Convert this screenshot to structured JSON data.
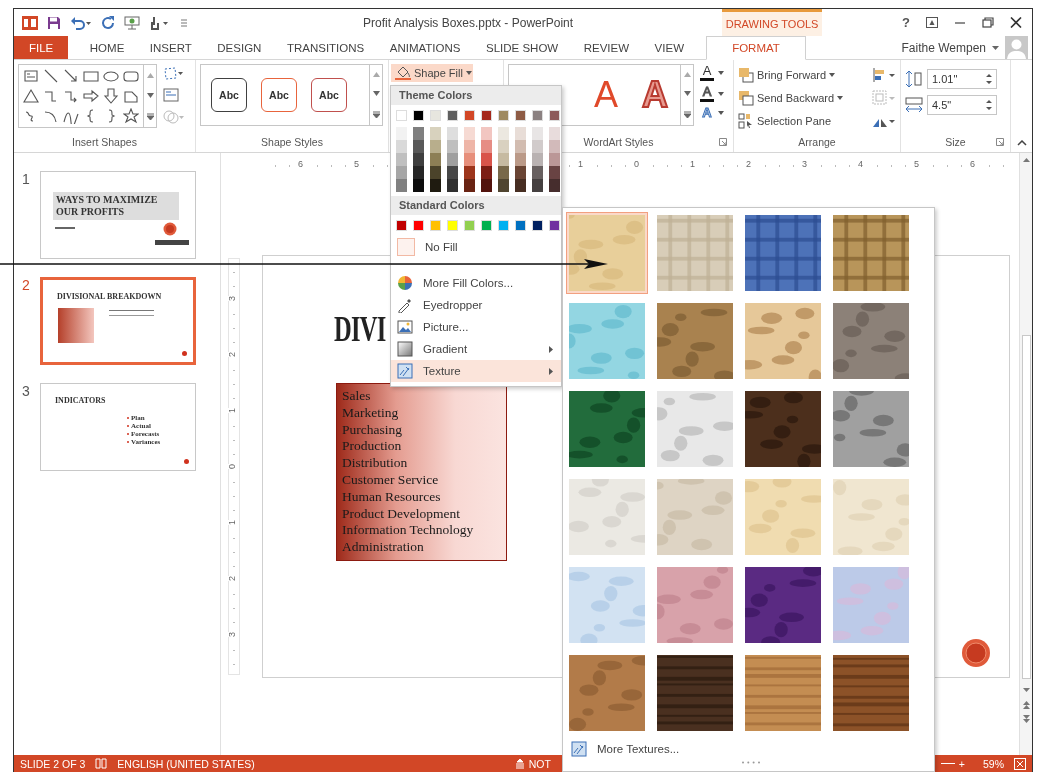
{
  "title_bar": {
    "title": "Profit Analysis Boxes.pptx - PowerPoint",
    "contextual_label": "DRAWING TOOLS",
    "help": "?"
  },
  "tabs": [
    {
      "label": "FILE",
      "kind": "file",
      "selected": false
    },
    {
      "label": "HOME",
      "kind": "tab",
      "selected": false
    },
    {
      "label": "INSERT",
      "kind": "tab",
      "selected": false
    },
    {
      "label": "DESIGN",
      "kind": "tab",
      "selected": false
    },
    {
      "label": "TRANSITIONS",
      "kind": "tab",
      "selected": false
    },
    {
      "label": "ANIMATIONS",
      "kind": "tab",
      "selected": false
    },
    {
      "label": "SLIDE SHOW",
      "kind": "tab",
      "selected": false
    },
    {
      "label": "REVIEW",
      "kind": "tab",
      "selected": false
    },
    {
      "label": "VIEW",
      "kind": "tab",
      "selected": false
    },
    {
      "label": "FORMAT",
      "kind": "contextual",
      "selected": true
    }
  ],
  "user": {
    "name": "Faithe Wempen"
  },
  "ribbon": {
    "insert_shapes": {
      "label": "Insert Shapes"
    },
    "shape_styles": {
      "label": "Shape Styles",
      "styles": [
        {
          "text": "Abc",
          "color": "#404040"
        },
        {
          "text": "Abc",
          "color": "#e8643c"
        },
        {
          "text": "Abc",
          "color": "#c0504d"
        }
      ]
    },
    "shape_fill": {
      "label": "Shape Fill",
      "expanded": true
    },
    "wordart_styles": {
      "label": "WordArt Styles",
      "styles": [
        {
          "text": "A",
          "kind": "fill"
        },
        {
          "text": "A",
          "kind": "outline"
        }
      ],
      "tools": [
        {
          "text": "A",
          "kind": "fill"
        },
        {
          "text": "A",
          "kind": "outline"
        },
        {
          "text": "A",
          "kind": "effects"
        }
      ]
    },
    "arrange": {
      "label": "Arrange",
      "buttons": [
        {
          "label": "Bring Forward",
          "dropdown": true
        },
        {
          "label": "Send Backward",
          "dropdown": true
        },
        {
          "label": "Selection Pane",
          "dropdown": false
        }
      ]
    },
    "size": {
      "label": "Size",
      "height": "1.01\"",
      "width": "4.5\""
    }
  },
  "fill_menu": {
    "theme_header": "Theme Colors",
    "theme_colors": [
      {
        "color": "#ffffff",
        "shades": [
          {
            "color": "#f2f2f2"
          },
          {
            "color": "#d9d9d9"
          },
          {
            "color": "#bfbfbf"
          },
          {
            "color": "#a6a6a6"
          },
          {
            "color": "#808080"
          }
        ]
      },
      {
        "color": "#000000",
        "shades": [
          {
            "color": "#7f7f7f"
          },
          {
            "color": "#595959"
          },
          {
            "color": "#3f3f3f"
          },
          {
            "color": "#262626"
          },
          {
            "color": "#0d0d0d"
          }
        ]
      },
      {
        "color": "#e7e6df",
        "shades": [
          {
            "color": "#d8d2be"
          },
          {
            "color": "#b8ae8c"
          },
          {
            "color": "#8d7f55"
          },
          {
            "color": "#4b432a"
          },
          {
            "color": "#1f1b10"
          }
        ]
      },
      {
        "color": "#5f5f5f",
        "shades": [
          {
            "color": "#dedede"
          },
          {
            "color": "#bfbfbf"
          },
          {
            "color": "#9f9f9f"
          },
          {
            "color": "#474747"
          },
          {
            "color": "#303030"
          }
        ]
      },
      {
        "color": "#d24726",
        "shades": [
          {
            "color": "#f6dad3"
          },
          {
            "color": "#eeb5a7"
          },
          {
            "color": "#e78f7b"
          },
          {
            "color": "#9d351c"
          },
          {
            "color": "#692313"
          }
        ]
      },
      {
        "color": "#a5281b",
        "shades": [
          {
            "color": "#f2c6c1"
          },
          {
            "color": "#e68d84"
          },
          {
            "color": "#d9544a"
          },
          {
            "color": "#7c1d14"
          },
          {
            "color": "#52130d"
          }
        ]
      },
      {
        "color": "#9e8a62",
        "shades": [
          {
            "color": "#ece8e0"
          },
          {
            "color": "#d9d1c0"
          },
          {
            "color": "#c6baa1"
          },
          {
            "color": "#786849"
          },
          {
            "color": "#504530"
          }
        ]
      },
      {
        "color": "#8e5c45",
        "shades": [
          {
            "color": "#e8ddd7"
          },
          {
            "color": "#d2bcb0"
          },
          {
            "color": "#bb9a88"
          },
          {
            "color": "#6a4534"
          },
          {
            "color": "#472e22"
          }
        ]
      },
      {
        "color": "#8b8181",
        "shades": [
          {
            "color": "#e8e5e5"
          },
          {
            "color": "#d1cbcb"
          },
          {
            "color": "#b9b2b2"
          },
          {
            "color": "#686060"
          },
          {
            "color": "#454040"
          }
        ]
      },
      {
        "color": "#8c5a5a",
        "shades": [
          {
            "color": "#e8dcdc"
          },
          {
            "color": "#d2baba"
          },
          {
            "color": "#bb9797"
          },
          {
            "color": "#694343"
          },
          {
            "color": "#462d2d"
          }
        ]
      }
    ],
    "standard_header": "Standard Colors",
    "standard_colors": [
      {
        "color": "#c00000"
      },
      {
        "color": "#ff0000"
      },
      {
        "color": "#ffc000"
      },
      {
        "color": "#ffff00"
      },
      {
        "color": "#92d050"
      },
      {
        "color": "#00b050"
      },
      {
        "color": "#00b0f0"
      },
      {
        "color": "#0070c0"
      },
      {
        "color": "#002060"
      },
      {
        "color": "#7030a0"
      }
    ],
    "items": [
      {
        "label": "No Fill",
        "kind": "swatch",
        "submenu": false,
        "selected": false
      },
      {
        "label": "More Fill Colors...",
        "kind": "command",
        "submenu": false,
        "selected": false
      },
      {
        "label": "Eyedropper",
        "kind": "command",
        "submenu": false,
        "selected": false
      },
      {
        "label": "Picture...",
        "kind": "command",
        "submenu": false,
        "selected": false
      },
      {
        "label": "Gradient",
        "kind": "command",
        "submenu": true,
        "selected": false
      },
      {
        "label": "Texture",
        "kind": "command",
        "submenu": true,
        "selected": true
      }
    ]
  },
  "texture_gallery": {
    "textures": [
      {
        "kind": "picture",
        "selected": true
      },
      {
        "kind": "picture",
        "selected": false
      },
      {
        "kind": "picture",
        "selected": false
      },
      {
        "kind": "picture",
        "selected": false
      },
      {
        "kind": "picture",
        "selected": false
      },
      {
        "kind": "picture",
        "selected": false
      },
      {
        "kind": "picture",
        "selected": false
      },
      {
        "kind": "picture",
        "selected": false
      },
      {
        "kind": "picture",
        "selected": false
      },
      {
        "kind": "picture",
        "selected": false
      },
      {
        "kind": "picture",
        "selected": false
      },
      {
        "kind": "picture",
        "selected": false
      },
      {
        "kind": "picture",
        "selected": false
      },
      {
        "kind": "picture",
        "selected": false
      },
      {
        "kind": "picture",
        "selected": false
      },
      {
        "kind": "picture",
        "selected": false
      },
      {
        "kind": "picture",
        "selected": false
      },
      {
        "kind": "picture",
        "selected": false
      },
      {
        "kind": "picture",
        "selected": false
      },
      {
        "kind": "picture",
        "selected": false
      },
      {
        "kind": "picture",
        "selected": false
      },
      {
        "kind": "picture",
        "selected": false
      },
      {
        "kind": "picture",
        "selected": false
      },
      {
        "kind": "picture",
        "selected": false
      }
    ],
    "more": "More Textures..."
  },
  "slides": [
    {
      "number": "1",
      "kind": "title",
      "selected": false,
      "title": "WAYS TO MAXIMIZE OUR PROFITS"
    },
    {
      "number": "2",
      "kind": "content",
      "selected": true,
      "title": "DIVISIONAL BREAKDOWN"
    },
    {
      "number": "3",
      "kind": "bullets",
      "selected": false,
      "title": "INDICATORS",
      "bullets": [
        "Plan",
        "Actual",
        "Forecasts",
        "Variances"
      ]
    }
  ],
  "horizontal_ruler": {
    "left_labels": [
      "6",
      "5"
    ],
    "right_labels": [
      "1",
      "0",
      "1",
      "2",
      "3",
      "4",
      "5",
      "6"
    ]
  },
  "vertical_ruler": [
    "3",
    "2",
    "1",
    "0",
    "1",
    "2",
    "3"
  ],
  "slide": {
    "title": "DIVI",
    "list": [
      "Sales",
      "Marketing",
      "Purchasing",
      "Production",
      "Distribution",
      "Customer Service",
      "Human Resources",
      "Product Development",
      "Information Technology",
      "Administration"
    ]
  },
  "status_bar": {
    "slide": "SLIDE 2 OF 3",
    "language": "ENGLISH (UNITED STATES)",
    "notes": "NOT",
    "zoom_in": "+",
    "zoom": "59%"
  }
}
